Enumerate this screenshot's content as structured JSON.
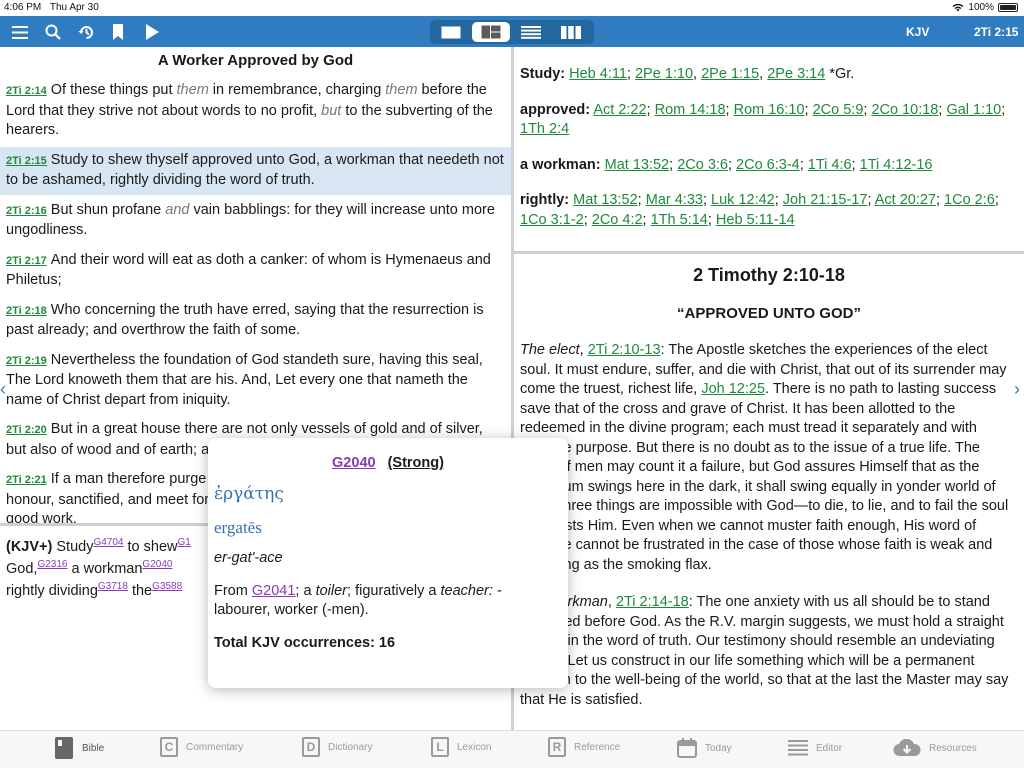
{
  "status": {
    "time": "4:06 PM",
    "date": "Thu Apr 30",
    "battery": "100%"
  },
  "toolbar": {
    "icons": [
      "menu-icon",
      "search-icon",
      "history-icon",
      "bookmark-icon",
      "play-icon"
    ],
    "layouts": [
      "single-pane",
      "four-pane",
      "list",
      "columns"
    ],
    "selected_layout": "four-pane",
    "version": "KJV",
    "reference": "2Ti 2:15"
  },
  "bible": {
    "heading": "A Worker Approved by God",
    "verses": [
      {
        "ref": "2Ti 2:14",
        "a": "Of these things put ",
        "i1": "them",
        "b": " in remembrance, charging ",
        "i2": "them",
        "c": " before the Lord that they strive not about words to no profit, ",
        "i3": "but",
        "d": " to the subverting of the hearers."
      },
      {
        "ref": "2Ti 2:15",
        "text": "Study to shew thyself approved unto God, a workman that needeth not to be ashamed, rightly dividing the word of truth."
      },
      {
        "ref": "2Ti 2:16",
        "a": "But shun profane ",
        "i1": "and",
        "b": " vain babblings: for they will increase unto more ungodliness."
      },
      {
        "ref": "2Ti 2:17",
        "text": "And their word will eat as doth a canker: of whom is Hymenaeus and Philetus;"
      },
      {
        "ref": "2Ti 2:18",
        "text": "Who concerning the truth have erred, saying that the resurrection is past already; and overthrow the faith of some."
      },
      {
        "ref": "2Ti 2:19",
        "text": "Nevertheless the foundation of God standeth sure, having this seal, The Lord knoweth them that are his. And, Let every one that nameth the name of Christ depart from iniquity."
      },
      {
        "ref": "2Ti 2:20",
        "text": "But in a great house there are not only vessels of gold and of silver, but also of wood and of earth; and some to honour, and some to dishonour."
      },
      {
        "ref": "2Ti 2:21",
        "text": "If a man therefore purge himself from these, he shall be a vessel unto honour, sanctified, and meet for the master's use, and prepared unto every good work."
      }
    ]
  },
  "kjvplus": {
    "label": "(KJV+)",
    "w1": "Study",
    "s1": "G4704",
    "w2": "to shew",
    "s2": "G1",
    "w3": "God,",
    "s3": "G2316",
    "w4": "a workman",
    "s4": "G2040",
    "w5": "rightly dividing",
    "s5": "G3718",
    "w6": "the",
    "s6": "G3588"
  },
  "xrefs": [
    {
      "label": "Study:",
      "links": [
        "Heb 4:11",
        "2Pe 1:10",
        "2Pe 1:15",
        "2Pe 3:14"
      ],
      "tail": "*Gr."
    },
    {
      "label": "approved:",
      "links": [
        "Act 2:22",
        "Rom 14:18",
        "Rom 16:10",
        "2Co 5:9",
        "2Co 10:18",
        "Gal 1:10",
        "1Th 2:4"
      ]
    },
    {
      "label": "a workman:",
      "links": [
        "Mat 13:52",
        "2Co 3:6",
        "2Co 6:3-4",
        "1Ti 4:6",
        "1Ti 4:12-16"
      ]
    },
    {
      "label": "rightly:",
      "links": [
        "Mat 13:52",
        "Mar 4:33",
        "Luk 12:42",
        "Joh 21:15-17",
        "Act 20:27",
        "1Co 2:6",
        "1Co 3:1-2",
        "2Co 4:2",
        "1Th 5:14",
        "Heb 5:11-14"
      ]
    }
  ],
  "commentary": {
    "title": "2 Timothy 2:10-18",
    "subtitle": "“APPROVED UNTO GOD”",
    "p1_lead": "The elect",
    "p1_ref": "2Ti 2:10-13",
    "p1_a": ": The Apostle sketches the experiences of the elect soul. It must endure, suffer, and die with Christ, that out of its surrender may come the truest, richest life,",
    "p1_ref2": "Joh 12:25",
    "p1_b": ". There is no path to lasting success save that of the cross and grave of Christ. It has been allotted to the redeemed in the divine program; each must tread it separately and with resolute purpose. But there is no doubt as to the issue of a true life. The world of men may count it a failure, but God assures Himself that as the pendulum swings here in the dark, it shall swing equally in yonder world of light. Three things are impossible with God—to die, to lie, and to fail the soul that trusts Him. Even when we cannot muster faith enough, His word of promise cannot be frustrated in the case of those whose faith is weak and trembling as the smoking flax.",
    "p2_lead": "The workman",
    "p2_ref": "2Ti 2:14-18",
    "p2_a": ": The one anxiety with us all should be to stand approved before God. As the R.V. margin suggests, we must hold a straight course in the word of truth. Our testimony should resemble an undeviating furrow. Let us construct in our life something which will be a permanent addition to the well-being of the world, so that at the last the Master may say that He is satisfied."
  },
  "popup": {
    "strongs": "G2040",
    "source": "(Strong)",
    "greek": "ἐργάτης",
    "translit": "ergatēs",
    "pronunciation": "er-gat'-ace",
    "from_label": "From",
    "from_ref": "G2041",
    "def_a": "; a ",
    "def_i1": "toiler",
    "def_b": "; figuratively a ",
    "def_i2": "teacher:",
    "def_c": " - labourer, worker (-men).",
    "occurrences": "Total KJV occurrences: 16"
  },
  "tabs": [
    {
      "label": "Bible",
      "icon": "bible-icon"
    },
    {
      "label": "Commentary",
      "icon": "commentary-icon"
    },
    {
      "label": "Dictionary",
      "icon": "dictionary-icon"
    },
    {
      "label": "Lexicon",
      "icon": "lexicon-icon"
    },
    {
      "label": "Reference",
      "icon": "reference-icon"
    },
    {
      "label": "Today",
      "icon": "calendar-icon"
    },
    {
      "label": "Editor",
      "icon": "editor-icon"
    },
    {
      "label": "Resources",
      "icon": "cloud-download-icon"
    }
  ]
}
